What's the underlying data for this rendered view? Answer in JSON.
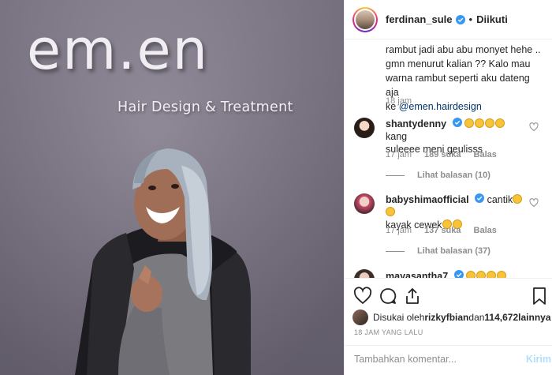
{
  "photo": {
    "brand_text": "em.en",
    "tagline": "Hair Design & Treatment"
  },
  "header": {
    "username": "ferdinan_sule",
    "separator": "•",
    "follow_status": "Diikuti"
  },
  "caption": {
    "line1": "rambut jadi abu abu monyet hehe ..",
    "line2": "gmn menurut kalian ?? Kalo mau",
    "line3": "warna rambut seperti aku dateng aja",
    "line4_prefix": "ke ",
    "link": "@emen.hairdesign",
    "time": "18 jam"
  },
  "comments": [
    {
      "user": "shantydenny",
      "text_a": " kang",
      "text_b": "suleeee meni geulisss",
      "time": "17 jam",
      "likes": "189 suka",
      "reply": "Balas",
      "view_replies": "Lihat balasan (10)"
    },
    {
      "user": "babyshimaofficial",
      "text_a": " cantik",
      "text_b": "kayak cewek",
      "time": "17 jam",
      "likes": "137 suka",
      "reply": "Balas",
      "view_replies": "Lihat balasan (37)"
    },
    {
      "user": "mayasantha7"
    }
  ],
  "likes": {
    "prefix": "Disukai oleh ",
    "user": "rizkyfbian",
    "middle": " dan ",
    "count": "114,672",
    "suffix": " lainnya"
  },
  "timestamp": "18 JAM YANG LALU",
  "add_comment": {
    "placeholder": "Tambahkan komentar...",
    "post_label": "Kirim"
  },
  "icons": {
    "like": "heart-icon",
    "comment": "comment-icon",
    "share": "share-icon",
    "save": "bookmark-icon",
    "verified": "verified-badge-icon"
  },
  "colors": {
    "verified": "#3897f0",
    "link": "#003569",
    "muted": "#8e8e8e",
    "post_disabled": "#b2dffc"
  }
}
